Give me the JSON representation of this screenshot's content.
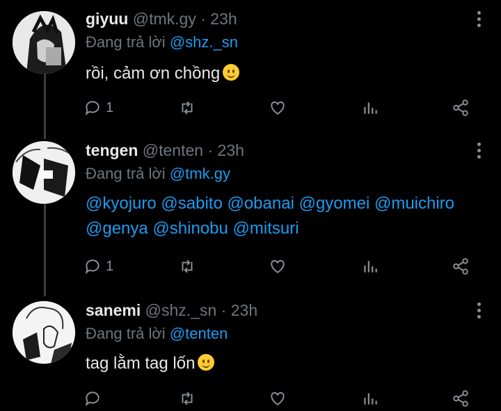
{
  "tweets": [
    {
      "name": "giyuu",
      "handle": "@tmk.gy",
      "time": "23h",
      "reply_prefix": "Đang trả lời",
      "reply_to": "@shz._sn",
      "text": "rồi, cảm ơn chồng",
      "reply_count": "1"
    },
    {
      "name": "tengen",
      "handle": "@tenten",
      "time": "23h",
      "reply_prefix": "Đang trả lời",
      "reply_to": "@tmk.gy",
      "line1": "@kyojuro @sabito @obanai @gyomei @muichiro",
      "line2": "@genya @shinobu @mitsuri",
      "reply_count": "1"
    },
    {
      "name": "sanemi",
      "handle": "@shz._sn",
      "time": "23h",
      "reply_prefix": "Đang trả lời",
      "reply_to": "@tenten",
      "text": "tag lằm tag lốn",
      "reply_count": ""
    }
  ],
  "separator": "·",
  "icons": [
    "reply-icon",
    "retweet-icon",
    "like-icon",
    "analytics-icon",
    "share-icon",
    "more-icon",
    "smile-emoji"
  ],
  "colors": {
    "background": "#000000",
    "mention": "#1d9bf0",
    "muted": "#6e767d",
    "text": "#e7e9ea"
  }
}
